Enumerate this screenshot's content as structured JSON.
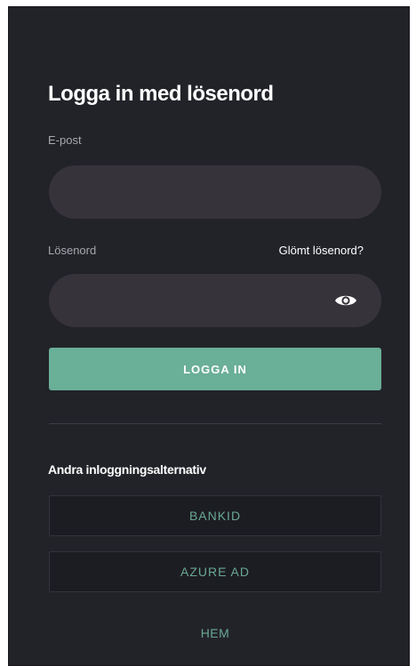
{
  "login": {
    "title": "Logga in med lösenord",
    "email_label": "E-post",
    "email_value": "",
    "password_label": "Lösenord",
    "password_value": "",
    "forgot_password": "Glömt lösenord?",
    "login_button": "LOGGA IN"
  },
  "alternatives": {
    "heading": "Andra inloggningsalternativ",
    "bankid": "BANKID",
    "azure_ad": "AZURE AD"
  },
  "footer": {
    "home": "HEM"
  },
  "icons": {
    "show_password": "eye-icon"
  },
  "colors": {
    "background": "#222329",
    "field": "#37333b",
    "accent": "#6aaf97",
    "accent_text": "#6aa892"
  }
}
